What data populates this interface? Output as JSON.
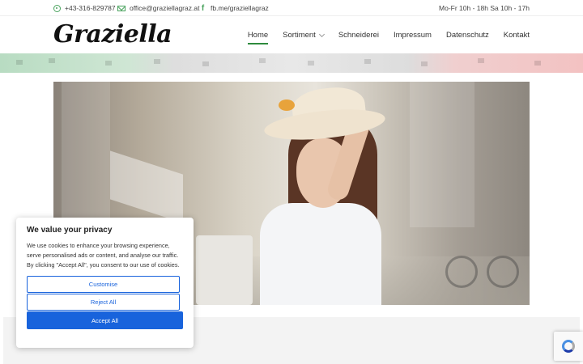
{
  "topbar": {
    "phone": "+43-316-829787",
    "email": "office@graziellagraz.at",
    "facebook": "fb.me/graziellagraz",
    "hours": "Mo-Fr 10h - 18h  Sa 10h - 17h"
  },
  "header": {
    "logo": "Graziella",
    "nav": [
      {
        "label": "Home",
        "active": true
      },
      {
        "label": "Sortiment",
        "has_dropdown": true
      },
      {
        "label": "Schneiderei"
      },
      {
        "label": "Impressum"
      },
      {
        "label": "Datenschutz"
      },
      {
        "label": "Kontakt"
      }
    ]
  },
  "cookie": {
    "title": "We value your privacy",
    "text": "We use cookies to enhance your browsing experience, serve personalised ads or content, and analyse our traffic. By clicking \"Accept All\", you consent to our use of cookies.",
    "customise": "Customise",
    "reject": "Reject All",
    "accept": "Accept All",
    "accent_color": "#1863dc"
  },
  "colors": {
    "accent_green": "#2e8b3d",
    "icon_green": "#4aa35e"
  },
  "icons": {
    "phone": "phone-icon",
    "email": "mail-icon",
    "facebook": "facebook-icon",
    "recaptcha": "recaptcha-icon"
  }
}
